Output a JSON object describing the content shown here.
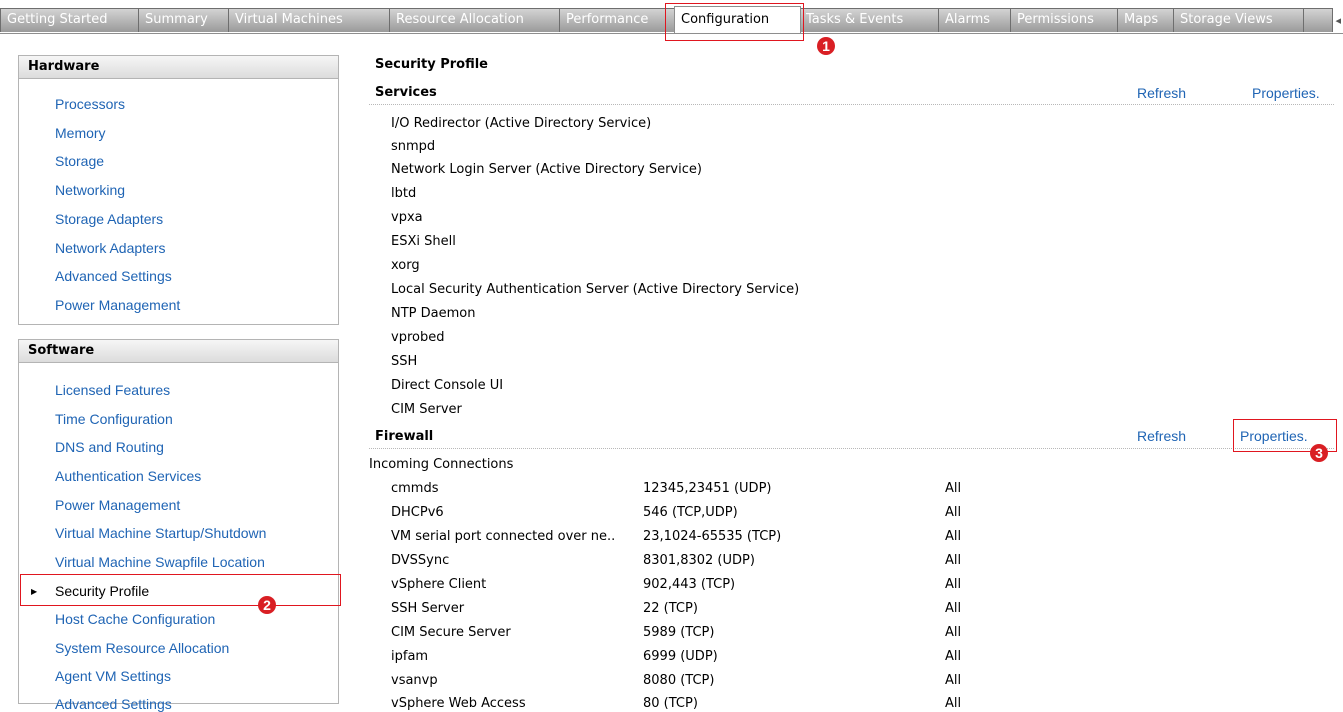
{
  "tabs": [
    "Getting Started",
    "Summary",
    "Virtual Machines",
    "Resource Allocation",
    "Performance",
    "Configuration",
    "Tasks & Events",
    "Alarms",
    "Permissions",
    "Maps",
    "Storage Views"
  ],
  "active_tab": "Configuration",
  "annotations": [
    "1",
    "2",
    "3"
  ],
  "hardware": {
    "header": "Hardware",
    "items": [
      "Processors",
      "Memory",
      "Storage",
      "Networking",
      "Storage Adapters",
      "Network Adapters",
      "Advanced Settings",
      "Power Management"
    ]
  },
  "software": {
    "header": "Software",
    "items": [
      "Licensed Features",
      "Time Configuration",
      "DNS and Routing",
      "Authentication Services",
      "Power Management",
      "Virtual Machine Startup/Shutdown",
      "Virtual Machine Swapfile Location",
      "Security Profile",
      "Host Cache Configuration",
      "System Resource Allocation",
      "Agent VM Settings",
      "Advanced Settings"
    ],
    "selected": "Security Profile"
  },
  "security_profile": {
    "title": "Security Profile",
    "services": {
      "label": "Services",
      "refresh": "Refresh",
      "properties": "Properties.",
      "items": [
        "I/O Redirector (Active Directory Service)",
        "snmpd",
        "Network Login Server (Active Directory Service)",
        "lbtd",
        "vpxa",
        "ESXi Shell",
        "xorg",
        "Local Security Authentication Server (Active Directory Service)",
        "NTP Daemon",
        "vprobed",
        "SSH",
        "Direct Console UI",
        "CIM Server"
      ]
    },
    "firewall": {
      "label": "Firewall",
      "refresh": "Refresh",
      "properties": "Properties.",
      "incoming_label": "Incoming Connections",
      "rows": [
        {
          "name": "cmmds",
          "ports": "12345,23451 (UDP)",
          "allowed": "All"
        },
        {
          "name": "DHCPv6",
          "ports": "546 (TCP,UDP)",
          "allowed": "All"
        },
        {
          "name": "VM serial port connected over ne..",
          "ports": "23,1024-65535 (TCP)",
          "allowed": "All"
        },
        {
          "name": "DVSSync",
          "ports": "8301,8302 (UDP)",
          "allowed": "All"
        },
        {
          "name": "vSphere Client",
          "ports": "902,443 (TCP)",
          "allowed": "All"
        },
        {
          "name": "SSH Server",
          "ports": "22 (TCP)",
          "allowed": "All"
        },
        {
          "name": "CIM Secure Server",
          "ports": "5989 (TCP)",
          "allowed": "All"
        },
        {
          "name": "ipfam",
          "ports": "6999 (UDP)",
          "allowed": "All"
        },
        {
          "name": "vsanvp",
          "ports": "8080 (TCP)",
          "allowed": "All"
        },
        {
          "name": "vSphere Web Access",
          "ports": "80 (TCP)",
          "allowed": "All"
        }
      ]
    }
  }
}
